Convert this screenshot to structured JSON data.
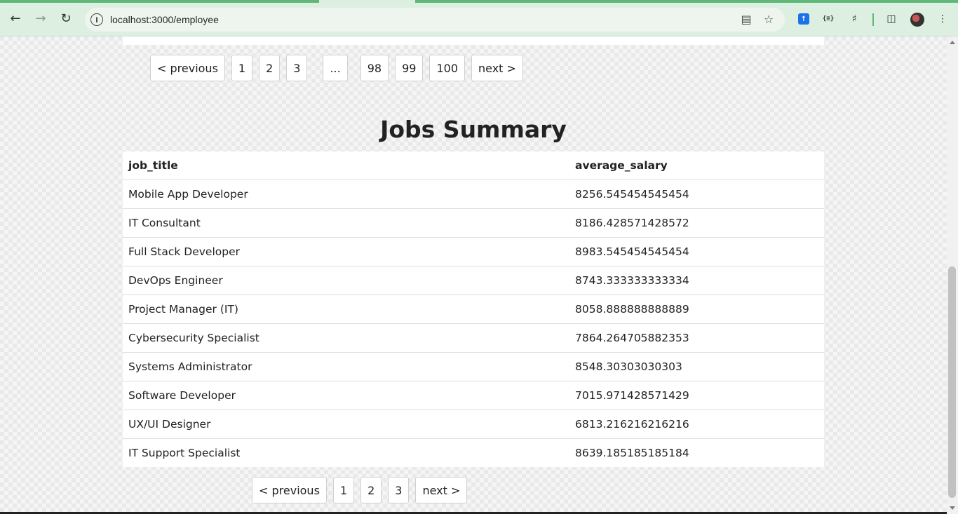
{
  "browser": {
    "url": "localhost:3000/employee",
    "info_icon_glyph": "i",
    "back_icon": "arrow-left",
    "forward_icon": "arrow-right",
    "reload_icon": "reload",
    "accent_color": "#5fb87a"
  },
  "top_pagination": {
    "items": [
      "< previous",
      "1",
      "2",
      "3",
      "...",
      "98",
      "99",
      "100",
      "next >"
    ]
  },
  "jobs_summary": {
    "title": "Jobs Summary",
    "columns": [
      "job_title",
      "average_salary"
    ],
    "rows": [
      [
        "Mobile App Developer",
        "8256.545454545454"
      ],
      [
        "IT Consultant",
        "8186.428571428572"
      ],
      [
        "Full Stack Developer",
        "8983.545454545454"
      ],
      [
        "DevOps Engineer",
        "8743.333333333334"
      ],
      [
        "Project Manager (IT)",
        "8058.888888888889"
      ],
      [
        "Cybersecurity Specialist",
        "7864.264705882353"
      ],
      [
        "Systems Administrator",
        "8548.30303030303"
      ],
      [
        "Software Developer",
        "7015.971428571429"
      ],
      [
        "UX/UI Designer",
        "6813.216216216216"
      ],
      [
        "IT Support Specialist",
        "8639.185185185184"
      ]
    ]
  },
  "bottom_pagination": {
    "items": [
      "< previous",
      "1",
      "2",
      "3",
      "next >"
    ]
  }
}
